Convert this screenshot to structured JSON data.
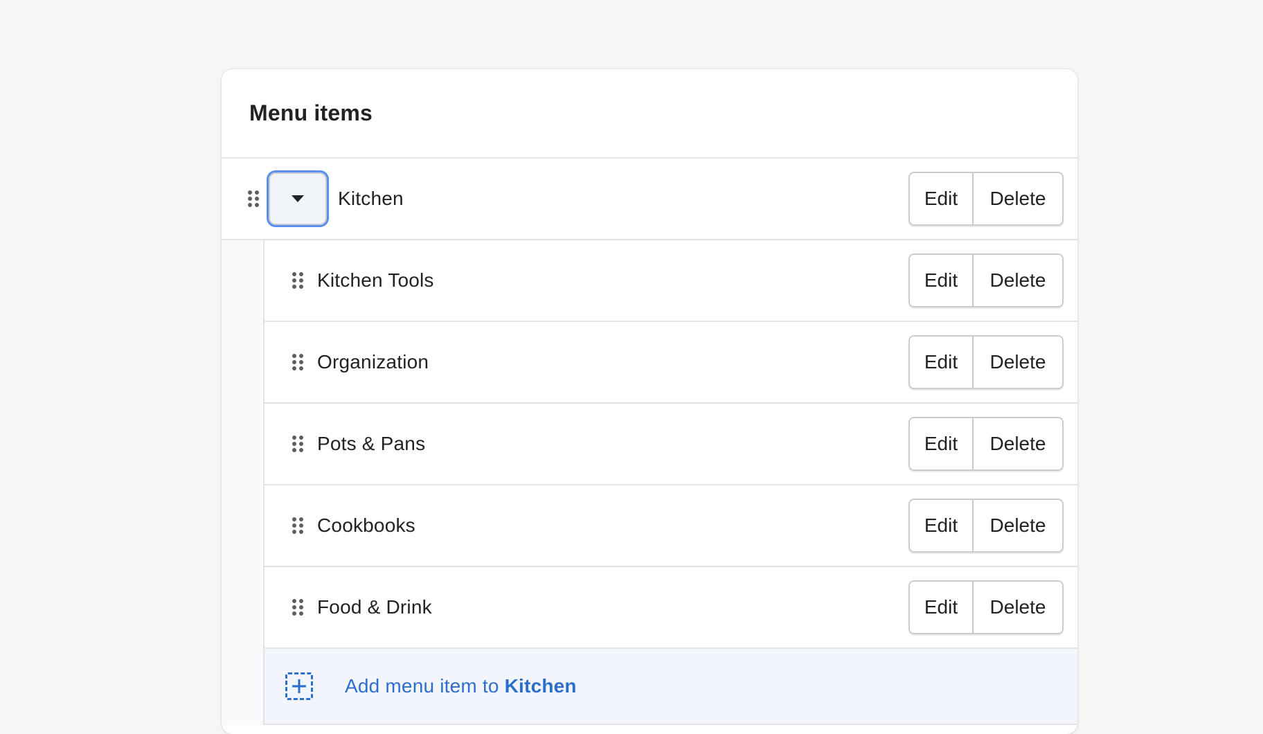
{
  "card": {
    "title": "Menu items"
  },
  "parent_item": {
    "label": "Kitchen",
    "edit_label": "Edit",
    "delete_label": "Delete"
  },
  "child_items": [
    {
      "label": "Kitchen Tools",
      "edit_label": "Edit",
      "delete_label": "Delete"
    },
    {
      "label": "Organization",
      "edit_label": "Edit",
      "delete_label": "Delete"
    },
    {
      "label": "Pots & Pans",
      "edit_label": "Edit",
      "delete_label": "Delete"
    },
    {
      "label": "Cookbooks",
      "edit_label": "Edit",
      "delete_label": "Delete"
    },
    {
      "label": "Food & Drink",
      "edit_label": "Edit",
      "delete_label": "Delete"
    }
  ],
  "add_item": {
    "prefix": "Add menu item to ",
    "target": "Kitchen"
  },
  "icons": {
    "drag": "drag-handle-icon",
    "toggle": "caret-down-icon",
    "add": "add-dashed-icon"
  },
  "colors": {
    "accent": "#2c6ecb",
    "focus_ring": "#5a8ef0",
    "background": "#f6f6f7",
    "text": "#202223"
  }
}
